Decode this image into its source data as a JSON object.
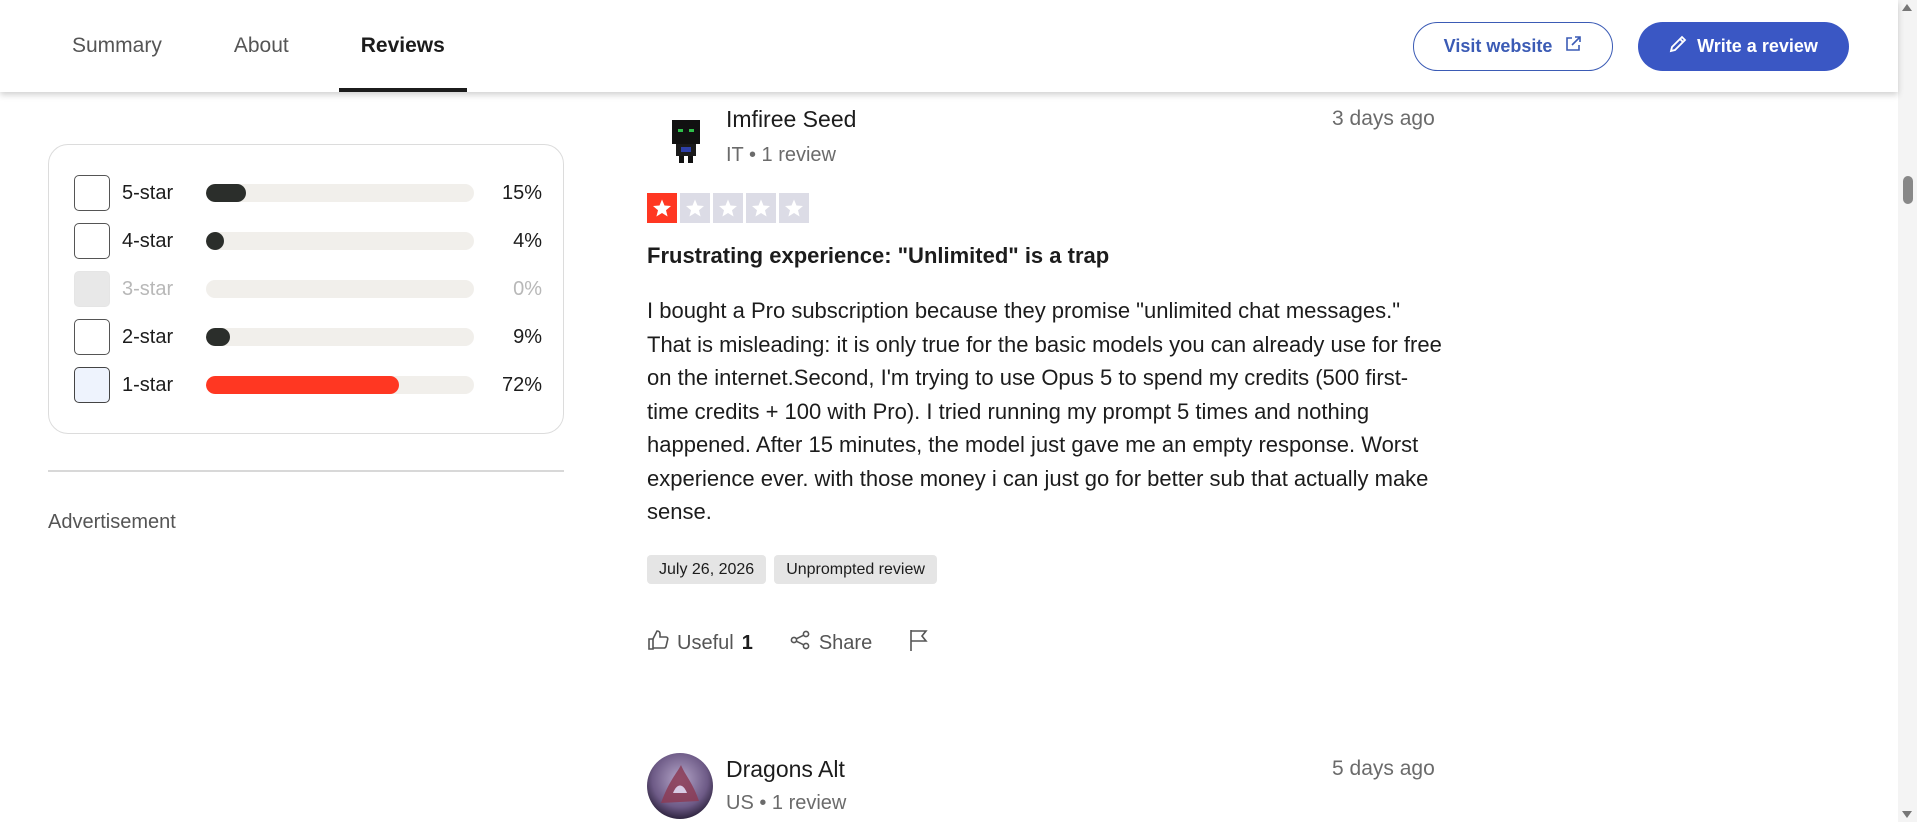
{
  "tabs": [
    {
      "label": "Summary"
    },
    {
      "label": "About"
    },
    {
      "label": "Reviews",
      "active": true
    }
  ],
  "header": {
    "visit_label": "Visit website",
    "write_label": "Write a review"
  },
  "filter": {
    "rows": [
      {
        "label": "5-star",
        "percent": "15%",
        "value": 15,
        "state": "unchecked"
      },
      {
        "label": "4-star",
        "percent": "4%",
        "value": 4,
        "state": "unchecked"
      },
      {
        "label": "3-star",
        "percent": "0%",
        "value": 0,
        "state": "disabled"
      },
      {
        "label": "2-star",
        "percent": "9%",
        "value": 9,
        "state": "unchecked"
      },
      {
        "label": "1-star",
        "percent": "72%",
        "value": 72,
        "state": "hovered"
      }
    ]
  },
  "sidebar": {
    "advertisement_label": "Advertisement"
  },
  "reviews": [
    {
      "name": "Imfiree Seed",
      "meta": "IT • 1 review",
      "date": "3 days ago",
      "rating": 1,
      "title": "Frustrating experience: \"Unlimited\" is a trap",
      "body": "I bought a Pro subscription because they promise \"unlimited chat messages.\" That is misleading: it is only true for the basic models you can already use for free on the internet.Second, I'm trying to use Opus 5 to spend my credits (500 first-time credits + 100 with Pro). I tried running my prompt 5 times and nothing happened. After 15 minutes, the model just gave me an empty response. Worst experience ever. with those money i can just go for better sub that actually make sense.",
      "chips": [
        "July 26, 2026",
        "Unprompted review"
      ],
      "useful_label": "Useful",
      "useful_count": "1",
      "share_label": "Share"
    },
    {
      "name": "Dragons Alt",
      "meta": "US • 1 review",
      "date": "5 days ago"
    }
  ],
  "colors": {
    "accent": "#3a57c4",
    "star_red": "#ff3722",
    "bar_dark": "#2b2e2b"
  }
}
